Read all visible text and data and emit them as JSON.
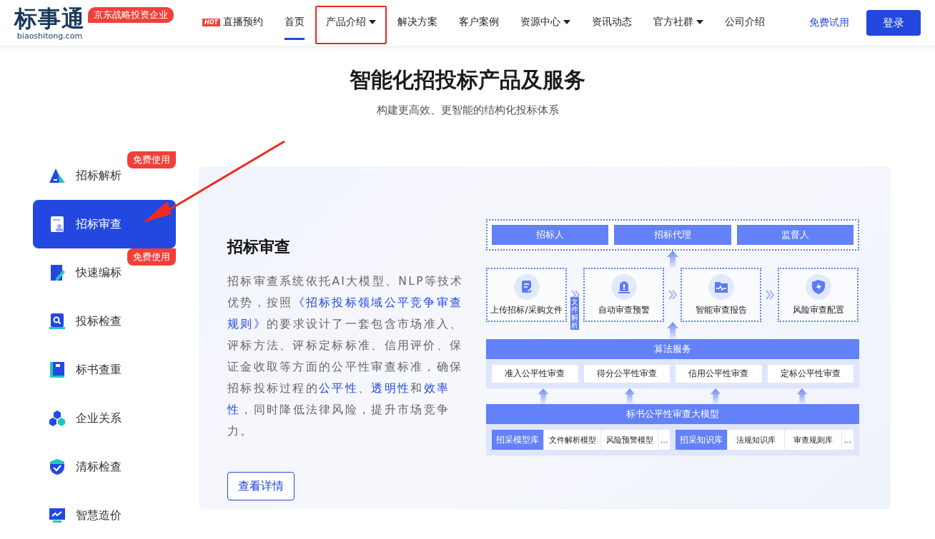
{
  "header": {
    "logo": {
      "name": "标事通",
      "domain": "biaoshitong.com",
      "badge": "京东战略投资企业"
    },
    "nav": [
      {
        "label": "直播预约",
        "badge": "HOT",
        "selected": false,
        "dropdown": false,
        "highlighted": false
      },
      {
        "label": "首页",
        "selected": true,
        "dropdown": false,
        "highlighted": false
      },
      {
        "label": "产品介绍",
        "selected": false,
        "dropdown": true,
        "highlighted": true
      },
      {
        "label": "解决方案",
        "selected": false,
        "dropdown": false,
        "highlighted": false
      },
      {
        "label": "客户案例",
        "selected": false,
        "dropdown": false,
        "highlighted": false
      },
      {
        "label": "资源中心",
        "selected": false,
        "dropdown": true,
        "highlighted": false
      },
      {
        "label": "资讯动态",
        "selected": false,
        "dropdown": false,
        "highlighted": false
      },
      {
        "label": "官方社群",
        "selected": false,
        "dropdown": true,
        "highlighted": false
      },
      {
        "label": "公司介绍",
        "selected": false,
        "dropdown": false,
        "highlighted": false
      }
    ],
    "trial_link": "免费试用",
    "login_button": "登录"
  },
  "hero": {
    "title": "智能化招投标产品及服务",
    "subtitle": "构建更高效、更智能的结构化投标体系"
  },
  "sidebar": {
    "items": [
      {
        "label": "招标解析",
        "selected": false,
        "badge": "免费使用"
      },
      {
        "label": "招标审查",
        "selected": true
      },
      {
        "label": "快速编标",
        "selected": false,
        "badge": "免费使用"
      },
      {
        "label": "投标检查",
        "selected": false
      },
      {
        "label": "标书查重",
        "selected": false
      },
      {
        "label": "企业关系",
        "selected": false
      },
      {
        "label": "清标检查",
        "selected": false
      },
      {
        "label": "智慧造价",
        "selected": false
      }
    ]
  },
  "product": {
    "title": "招标审查",
    "description": [
      {
        "text": "招标审查系统依托AI大模型、NLP等技术优势，按照",
        "highlight": false
      },
      {
        "text": "《招标投标领域公平竞争审查规则》",
        "highlight": true
      },
      {
        "text": "的要求设计了一套包含市场准入、评标方法、评标定标标准、信用评价、保证金收取等方面的公平性审查标准，确保招标投标过程的",
        "highlight": false
      },
      {
        "text": "公平性",
        "highlight": true
      },
      {
        "text": "、",
        "highlight": false
      },
      {
        "text": "透明性",
        "highlight": true
      },
      {
        "text": "和",
        "highlight": false
      },
      {
        "text": "效率性",
        "highlight": true
      },
      {
        "text": "，同时降低法律风险，提升市场竞争力。",
        "highlight": false
      }
    ],
    "details_button": "查看详情",
    "diagram": {
      "roles": [
        "招标人",
        "招标代理",
        "监督人"
      ],
      "steps": [
        "上传招标/采购文件",
        "自动审查预警",
        "智能审查报告",
        "风险审查配置"
      ],
      "step_tag": "文件解析",
      "algorithm": {
        "title": "算法服务",
        "items": [
          "准入公平性审查",
          "得分公平性审查",
          "信用公平性审查",
          "定标公平性审查"
        ]
      },
      "model": {
        "title": "标书公平性审查大模型",
        "groups": [
          {
            "title": "招采模型库",
            "items": [
              "文件解析模型",
              "风险预警模型",
              "..."
            ]
          },
          {
            "title": "招采知识库",
            "items": [
              "法规知识库",
              "审查规则库",
              "..."
            ]
          }
        ]
      }
    }
  }
}
